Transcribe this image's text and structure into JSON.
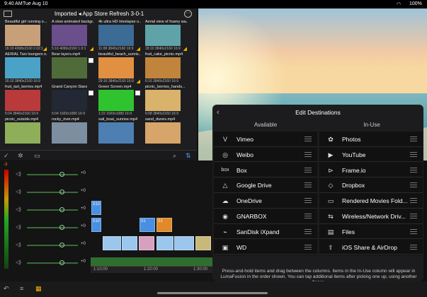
{
  "status": {
    "time": "9:40 AM",
    "date": "Tue Aug 10",
    "battery": "100%"
  },
  "browser": {
    "title": "Imported ◂ App Store Refresh 3-0-1",
    "items": [
      {
        "label": "Beautiful girl running o...",
        "meta": "16:10  4368x2160  2.02:1",
        "color": "#c7a07a",
        "checked": false,
        "tick": true
      },
      {
        "label": "A slow animated backgr...",
        "meta": "5:16  4096x2160  1.9:1",
        "color": "#6b4e8c",
        "checked": false,
        "tick": true
      },
      {
        "label": "4k ultra HD timelapse o...",
        "meta": "11:08  3840x2160  16:9",
        "color": "#3c6b95",
        "checked": false,
        "tick": true
      },
      {
        "label": "Aerial view of foamy wa...",
        "meta": "18:10  3840x2160  16:9",
        "color": "#5fa3a8",
        "checked": false,
        "tick": true
      },
      {
        "label": "AERIAL Two loungers o...",
        "meta": "16:10  3840x2160  16:9",
        "color": "#4aa3c7",
        "checked": false,
        "tick": false
      },
      {
        "label": "Bear layers.mp4",
        "meta": "",
        "color": "#4f6b3a",
        "checked": true,
        "tick": false
      },
      {
        "label": "beautiful_beach_sunris...",
        "meta": "29:16  3840x2160  16:9",
        "color": "#e09040",
        "checked": false,
        "tick": true
      },
      {
        "label": "fruit_cake_picnic.mp4",
        "meta": "6:16  3840x2160  16:9",
        "color": "#c0843c",
        "checked": false,
        "tick": false
      },
      {
        "label": "fruit_tart_berries.mp4",
        "meta": "5:04  3840x2160  16:9",
        "color": "#b83a3a",
        "checked": false,
        "tick": false
      },
      {
        "label": "Grand Canyon Stars",
        "meta": "5:04  1920x1080  16:9",
        "color": "#222834",
        "checked": true,
        "tick": false
      },
      {
        "label": "Green Screen.mp4",
        "meta": "1:22  1920x1080  16:9",
        "color": "#2fc42f",
        "checked": true,
        "tick": false
      },
      {
        "label": "picnic_berries_hands...",
        "meta": "6:08  3840x2160  16:9",
        "color": "#d9b26b",
        "checked": false,
        "tick": false
      },
      {
        "label": "picnic_outside.mp4",
        "meta": "",
        "color": "#8fae5a",
        "checked": false,
        "tick": false
      },
      {
        "label": "rocky_river.mp4",
        "meta": "",
        "color": "#7c8fa0",
        "checked": false,
        "tick": false
      },
      {
        "label": "sail_boat_sunrise.mp4",
        "meta": "",
        "color": "#4d7fb3",
        "checked": false,
        "tick": false
      },
      {
        "label": "sand_dunes.mp4",
        "meta": "",
        "color": "#d7a46a",
        "checked": false,
        "tick": false
      }
    ]
  },
  "timeline": {
    "rows": [
      "+0",
      "+0",
      "+0",
      "+0",
      "+0",
      "+0"
    ],
    "level": "-3",
    "clips": [
      "3:10",
      "3:11",
      "3:1",
      "3:1"
    ],
    "times": [
      "1:10:00",
      "1:20:00",
      "1:30:00"
    ]
  },
  "dialog": {
    "title": "Edit Destinations",
    "available_label": "Available",
    "inuse_label": "In-Use",
    "available": [
      {
        "label": "Vimeo",
        "icon": "vimeo-icon",
        "glyph": "V"
      },
      {
        "label": "Weibo",
        "icon": "weibo-icon",
        "glyph": "◎"
      },
      {
        "label": "Box",
        "icon": "box-icon",
        "glyph": "box"
      },
      {
        "label": "Google Drive",
        "icon": "google-drive-icon",
        "glyph": "△"
      },
      {
        "label": "OneDrive",
        "icon": "onedrive-icon",
        "glyph": "☁"
      },
      {
        "label": "GNARBOX",
        "icon": "gnarbox-icon",
        "glyph": "◉"
      },
      {
        "label": "SanDisk iXpand",
        "icon": "sandisk-icon",
        "glyph": "⌁"
      },
      {
        "label": "WD",
        "icon": "wd-icon",
        "glyph": "▣"
      }
    ],
    "inuse": [
      {
        "label": "Photos",
        "icon": "photos-icon",
        "glyph": "✿"
      },
      {
        "label": "YouTube",
        "icon": "youtube-icon",
        "glyph": "▶"
      },
      {
        "label": "Frame.io",
        "icon": "frameio-icon",
        "glyph": "⊳"
      },
      {
        "label": "Dropbox",
        "icon": "dropbox-icon",
        "glyph": "◇"
      },
      {
        "label": "Rendered Movies Fold...",
        "icon": "folder-icon",
        "glyph": "▭"
      },
      {
        "label": "Wireless/Network Driv...",
        "icon": "network-drive-icon",
        "glyph": "⇆"
      },
      {
        "label": "Files",
        "icon": "files-icon",
        "glyph": "▤"
      },
      {
        "label": "iOS Share & AirDrop",
        "icon": "share-icon",
        "glyph": "⇪"
      }
    ],
    "hint": "Press-and-hold items and drag between the columns. Items in the In-Use column will appear in LumaFusion in the order shown. You can tap additional items after picking one up, using another finger."
  }
}
